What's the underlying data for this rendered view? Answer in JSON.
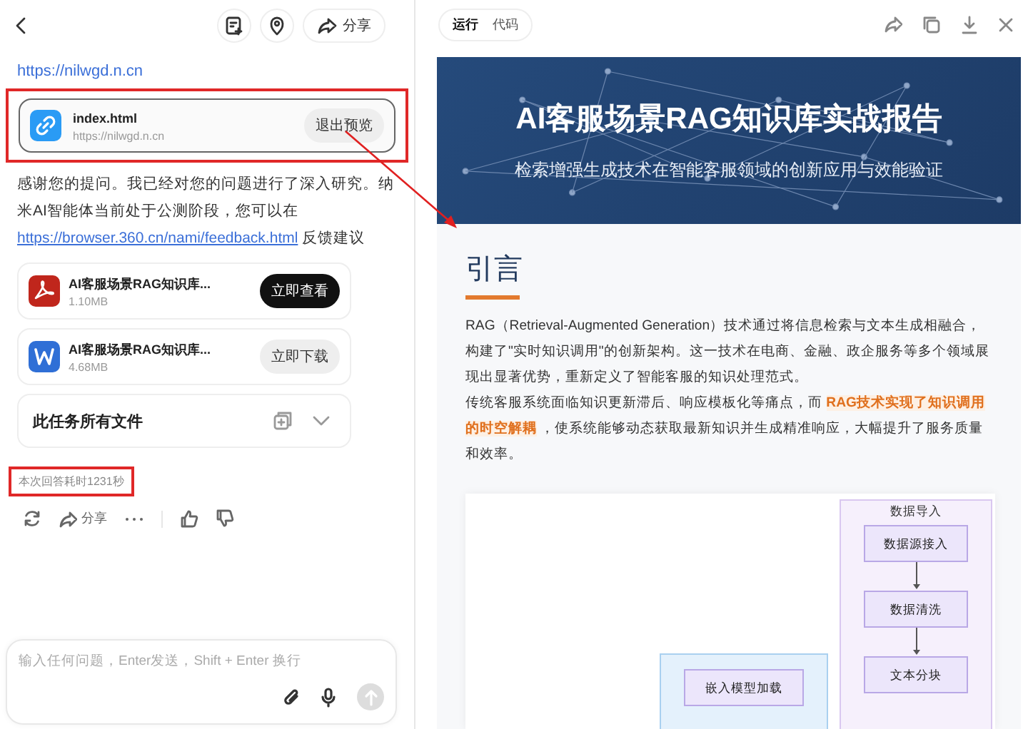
{
  "left_panel": {
    "header": {
      "share_button": "分享"
    },
    "site_link": "https://nilwgd.n.cn",
    "preview_card": {
      "title": "index.html",
      "url": "https://nilwgd.n.cn",
      "button": "退出预览",
      "highlighted": true
    },
    "message": {
      "text": "感谢您的提问。我已经对您的问题进行了深入研究。纳米AI智能体当前处于公测阶段，您可以在 ",
      "link": "https://browser.360.cn/nami/feedback.html",
      "after": " 反馈建议"
    },
    "files": [
      {
        "kind": "pdf",
        "name": "AI客服场景RAG知识库...",
        "size": "1.10MB",
        "button": "立即查看",
        "primary": true
      },
      {
        "kind": "word",
        "name": "AI客服场景RAG知识库...",
        "size": "4.68MB",
        "button": "立即下载",
        "primary": false
      }
    ],
    "all_files": {
      "label": "此任务所有文件",
      "expanded": false
    },
    "elapsed": {
      "text": "本次回答耗时1231秒",
      "highlighted": true
    },
    "actions": {
      "share": "分享"
    },
    "input": {
      "placeholder": "输入任何问题，Enter发送，Shift + Enter 换行"
    }
  },
  "right_panel": {
    "tabs": [
      {
        "label": "运行",
        "selected": true
      },
      {
        "label": "代码",
        "selected": false
      }
    ],
    "banner": {
      "title": "AI客服场景RAG知识库实战报告",
      "subtitle": "检索增强生成技术在智能客服领域的创新应用与效能验证"
    },
    "section": {
      "heading": "引言",
      "paragraphs": [
        [
          {
            "kind": "plain",
            "text": "RAG（Retrieval-Augmented Generation）技术通过将信息检索与文本生成相融合，构建了\"实时知识调用\"的创新架构。这一技术在电商、金融、政企服务等多个领域展现出显著优势，重新定义了智能客服的知识处理范式。"
          }
        ],
        [
          {
            "kind": "plain",
            "text": "传统客服系统面临知识更新滞后、响应模板化等痛点，而 "
          },
          {
            "kind": "highlight",
            "text": "RAG技术实现了知识调用的时空解耦"
          },
          {
            "kind": "plain",
            "text": " ，使系统能够动态获取最新知识并生成精准响应，大幅提升了服务质量和效率。"
          }
        ]
      ]
    },
    "diagram": {
      "groups": [
        {
          "kind": "lavender",
          "title": "数据导入",
          "nodes": [
            "数据源接入",
            "数据清洗",
            "文本分块"
          ]
        },
        {
          "kind": "blue",
          "nodes": [
            "嵌入模型加载"
          ]
        }
      ]
    }
  }
}
